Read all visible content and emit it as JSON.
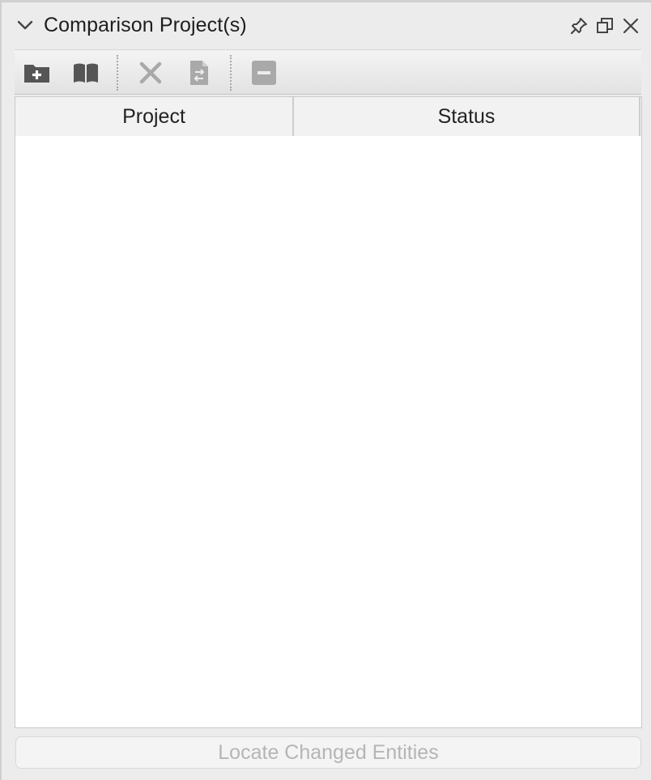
{
  "panel": {
    "title": "Comparison Project(s)",
    "collapse_icon": "chevron-down-icon",
    "actions": [
      "pin-icon",
      "float-window-icon",
      "close-icon"
    ]
  },
  "toolbar": {
    "tools": [
      {
        "icon": "add-folder-icon",
        "enabled": true
      },
      {
        "icon": "open-book-icon",
        "enabled": true
      },
      {
        "icon": "delete-x-icon",
        "enabled": false
      },
      {
        "icon": "swap-file-icon",
        "enabled": false
      },
      {
        "icon": "remove-minus-icon",
        "enabled": false
      }
    ]
  },
  "table": {
    "columns": [
      "Project",
      "Status"
    ],
    "rows": []
  },
  "footer": {
    "locate_label": "Locate Changed Entities",
    "locate_enabled": false
  },
  "colors": {
    "panel_bg": "#ececec",
    "icon_enabled": "#555555",
    "icon_disabled": "#a9a9a9",
    "disabled_text": "#b5b5b5"
  }
}
